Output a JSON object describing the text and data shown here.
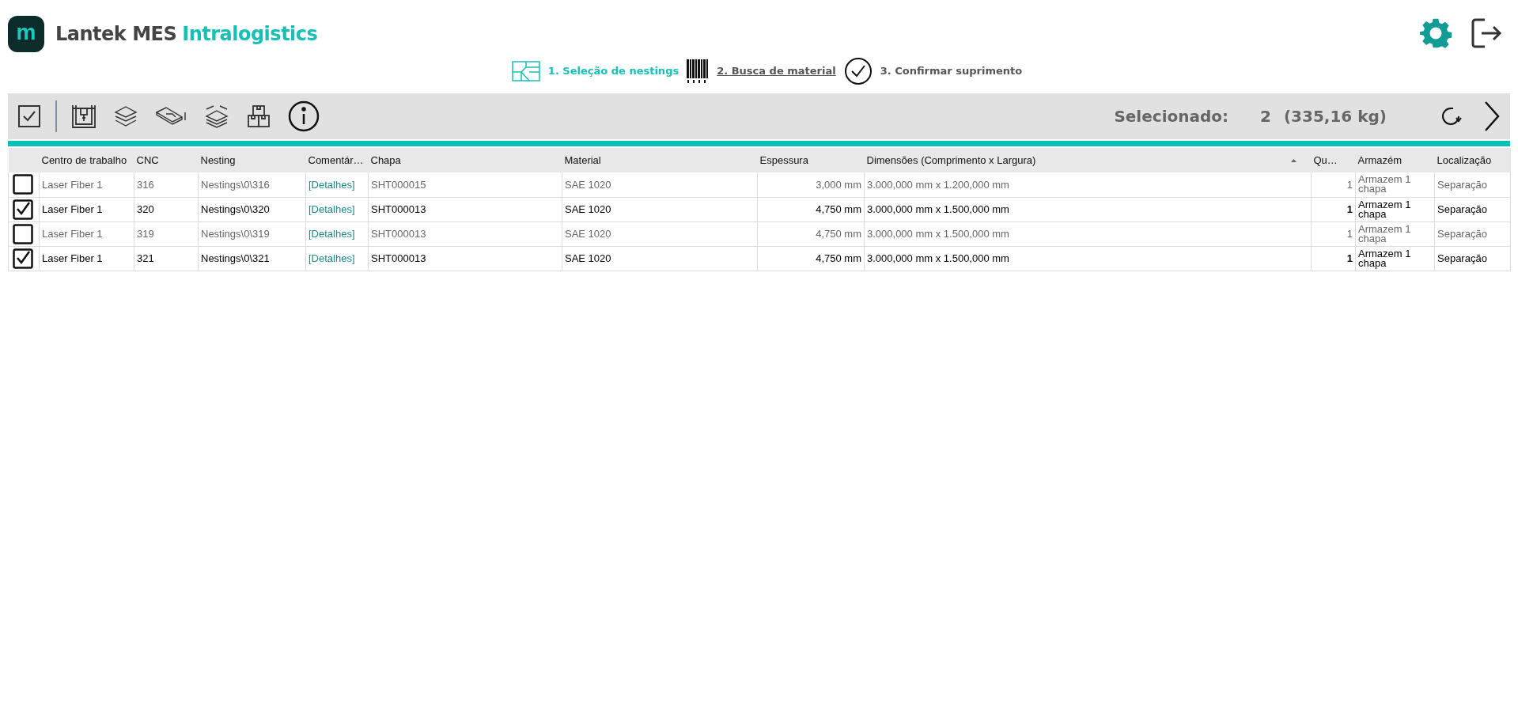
{
  "app": {
    "logo_letter": "m",
    "title": "Lantek MES",
    "title_accent": "Intralogistics"
  },
  "steps": [
    {
      "label": "1. Seleção de nestings",
      "kind": "nesting",
      "selected": true,
      "link": false
    },
    {
      "label": "2. Busca de material",
      "kind": "barcode",
      "selected": false,
      "link": true
    },
    {
      "label": "3. Confirmar suprimento",
      "kind": "check",
      "selected": false,
      "link": false
    }
  ],
  "toolbar": {
    "selected_label": "Selecionado:",
    "selected_count": "2",
    "selected_weight": "(335,16 kg)"
  },
  "table": {
    "columns": [
      {
        "label": "Centro de trabalho"
      },
      {
        "label": "CNC"
      },
      {
        "label": "Nesting"
      },
      {
        "label": "Comentár…"
      },
      {
        "label": "Chapa"
      },
      {
        "label": "Material"
      },
      {
        "label": "Espessura"
      },
      {
        "label": "Dimensões (Comprimento x Largura)",
        "sorted": true
      },
      {
        "label": "Qu…"
      },
      {
        "label": "Armazém"
      },
      {
        "label": "Localização"
      }
    ],
    "rows": [
      {
        "checked": false,
        "cells": [
          "Laser Fiber 1",
          "316",
          "Nestings\\0\\316",
          "[Detalhes]",
          "SHT000015",
          "SAE 1020",
          "3,000 mm",
          "3.000,000 mm x 1.200,000 mm",
          "1",
          "Armazem 1 chapa",
          "Separação"
        ]
      },
      {
        "checked": true,
        "cells": [
          "Laser Fiber 1",
          "320",
          "Nestings\\0\\320",
          "[Detalhes]",
          "SHT000013",
          "SAE 1020",
          "4,750 mm",
          "3.000,000 mm x 1.500,000 mm",
          "1",
          "Armazem 1 chapa",
          "Separação"
        ]
      },
      {
        "checked": false,
        "cells": [
          "Laser Fiber 1",
          "319",
          "Nestings\\0\\319",
          "[Detalhes]",
          "SHT000013",
          "SAE 1020",
          "4,750 mm",
          "3.000,000 mm x 1.500,000 mm",
          "1",
          "Armazem 1 chapa",
          "Separação"
        ]
      },
      {
        "checked": true,
        "cells": [
          "Laser Fiber 1",
          "321",
          "Nestings\\0\\321",
          "[Detalhes]",
          "SHT000013",
          "SAE 1020",
          "4,750 mm",
          "3.000,000 mm x 1.500,000 mm",
          "1",
          "Armazem 1 chapa",
          "Separação"
        ]
      }
    ]
  }
}
